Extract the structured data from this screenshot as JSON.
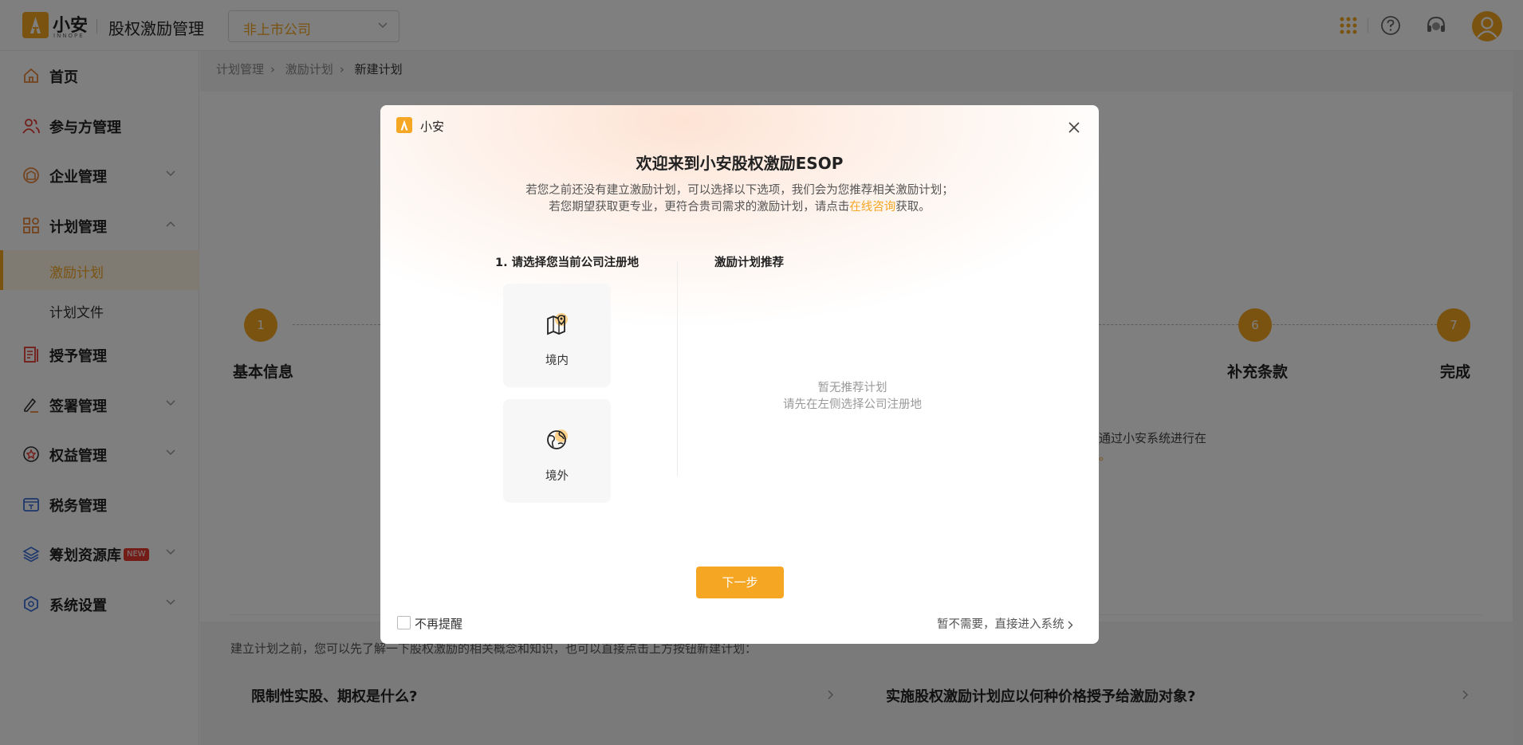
{
  "header": {
    "logo_text": "小安",
    "logo_sub": "INNOPE",
    "app_title": "股权激励管理",
    "company_select": "非上市公司"
  },
  "sidebar": {
    "items": [
      {
        "label": "首页",
        "icon": "home-icon"
      },
      {
        "label": "参与方管理",
        "icon": "users-icon"
      },
      {
        "label": "企业管理",
        "icon": "enterprise-icon"
      },
      {
        "label": "计划管理",
        "icon": "plan-icon"
      },
      {
        "label": "激励计划"
      },
      {
        "label": "计划文件"
      },
      {
        "label": "授予管理",
        "icon": "grant-icon"
      },
      {
        "label": "签署管理",
        "icon": "sign-icon"
      },
      {
        "label": "权益管理",
        "icon": "equity-icon"
      },
      {
        "label": "税务管理",
        "icon": "tax-icon"
      },
      {
        "label": "筹划资源库",
        "icon": "resource-icon",
        "badge": "NEW"
      },
      {
        "label": "系统设置",
        "icon": "settings-icon"
      }
    ]
  },
  "breadcrumb": [
    "计划管理",
    "激励计划",
    "新建计划"
  ],
  "steps": [
    {
      "num": "1",
      "label": "基本信息"
    },
    {
      "num": "6",
      "label": "补充条款"
    },
    {
      "num": "7",
      "label": "完成"
    }
  ],
  "background_text": {
    "fragment1": "通过小安系统进行在",
    "fragment2": "。",
    "faq_intro": "建立计划之前，您可以先了解一下股权激励的相关概念和知识，也可以直接点击上方按钮新建计划："
  },
  "faq": [
    "限制性实股、期权是什么?",
    "实施股权激励计划应以何种价格授予给激励对象?"
  ],
  "modal": {
    "brand": "小安",
    "title": "欢迎来到小安股权激励ESOP",
    "desc_line1": "若您之前还没有建立激励计划，可以选择以下选项，我们会为您推荐相关激励计划；",
    "desc_line2_pre": "若您期望获取更专业，更符合贵司需求的激励计划，请点击",
    "desc_line2_link": "在线咨询",
    "desc_line2_post": "获取。",
    "left_title": "1. 请选择您当前公司注册地",
    "right_title": "激励计划推荐",
    "regions": [
      {
        "label": "境内",
        "icon": "domestic-map-icon"
      },
      {
        "label": "境外",
        "icon": "overseas-globe-icon"
      }
    ],
    "empty_line1": "暂无推荐计划",
    "empty_line2": "请先在左侧选择公司注册地",
    "next_button": "下一步",
    "no_remind": "不再提醒",
    "skip": "暂不需要，直接进入系统"
  },
  "colors": {
    "accent": "#f5a623",
    "badge": "#e8392f",
    "overlay": "rgba(0,0,0,0.5)"
  }
}
